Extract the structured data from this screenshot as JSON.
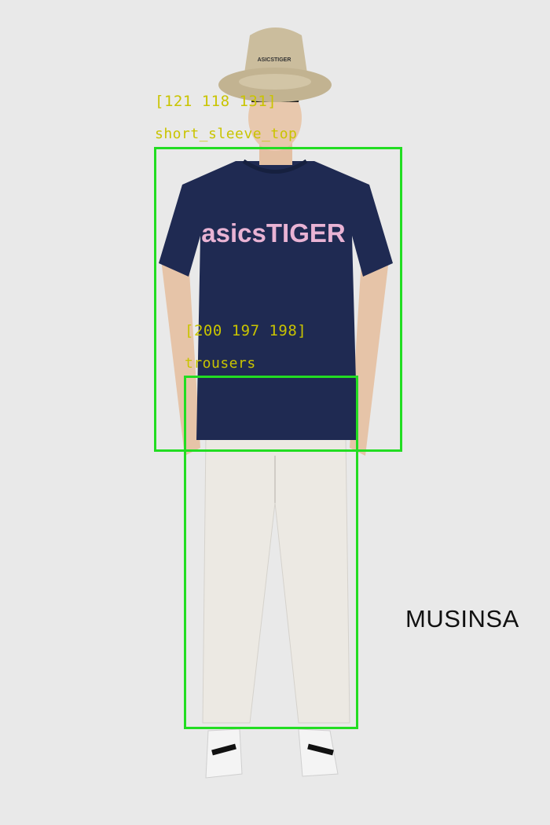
{
  "image": {
    "background_color": "#e9e9e9",
    "shirt_print": "asicsTIGER",
    "hat_print": "ASICSTIGER",
    "watermark": "MUSINSA"
  },
  "annotations": [
    {
      "color_label": "[121 118 131]",
      "class_label": "short_sleeve_top",
      "box_color": "#22dd22",
      "text_color": "#c9c400"
    },
    {
      "color_label": "[200 197 198]",
      "class_label": "trousers",
      "box_color": "#22dd22",
      "text_color": "#c9c400"
    }
  ]
}
